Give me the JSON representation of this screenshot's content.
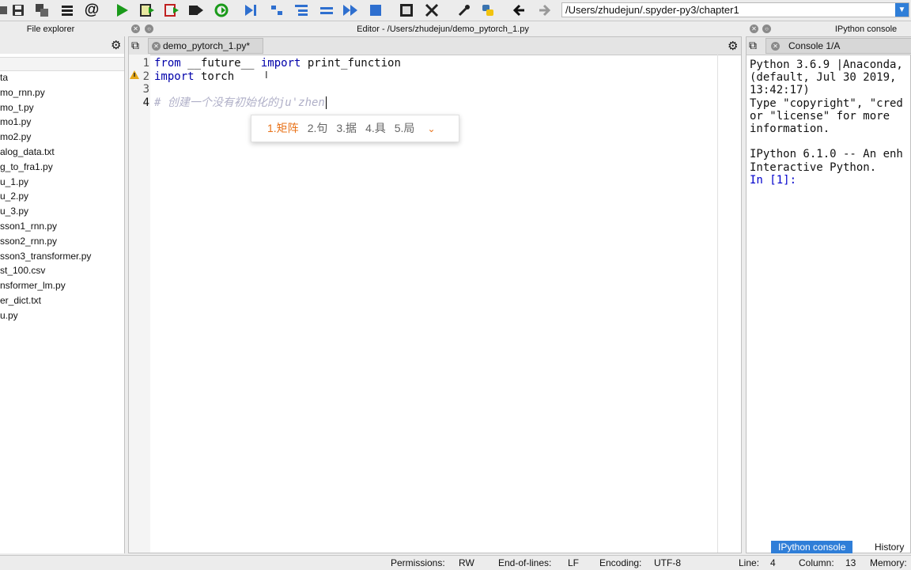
{
  "toolbar": {
    "path": "/Users/zhudejun/.spyder-py3/chapter1"
  },
  "file_explorer": {
    "title": "File explorer",
    "items": [
      "ta",
      "mo_rnn.py",
      "mo_t.py",
      "mo1.py",
      "mo2.py",
      "alog_data.txt",
      "g_to_fra1.py",
      "u_1.py",
      "u_2.py",
      "u_3.py",
      "sson1_rnn.py",
      "sson2_rnn.py",
      "sson3_transformer.py",
      "st_100.csv",
      "nsformer_lm.py",
      "er_dict.txt",
      "u.py"
    ]
  },
  "editor": {
    "title": "Editor - /Users/zhudejun/demo_pytorch_1.py",
    "tab_label": "demo_pytorch_1.py*",
    "line_numbers": [
      "1",
      "2",
      "3",
      "4"
    ],
    "lines": {
      "l1_kw1": "from",
      "l1_rest": " __future__ ",
      "l1_kw2": "import",
      "l1_rest2": " print_function",
      "l2_kw": "import",
      "l2_rest": " torch",
      "l4_comment": "# 创建一个没有初始化的ju'zhen"
    },
    "ime_candidates": [
      "1.矩阵",
      "2.句",
      "3.据",
      "4.具",
      "5.局"
    ]
  },
  "console": {
    "title": "IPython console",
    "tab_label": "Console 1/A",
    "text": "Python 3.6.9 |Anaconda,\n(default, Jul 30 2019,\n13:42:17)\nType \"copyright\", \"cred\nor \"license\" for more\ninformation.\n\nIPython 6.1.0 -- An enh\nInteractive Python.\n",
    "prompt": "In [1]:",
    "bottom_tabs": [
      "IPython console",
      "History"
    ]
  },
  "status": {
    "permissions_label": "Permissions:",
    "permissions": "RW",
    "eol_label": "End-of-lines:",
    "eol": "LF",
    "encoding_label": "Encoding:",
    "encoding": "UTF-8",
    "line_label": "Line:",
    "line": "4",
    "column_label": "Column:",
    "column": "13",
    "memory_label": "Memory:"
  },
  "colors": {
    "accent": "#2f7ed8",
    "keyword": "#0000aa",
    "comment": "#b0b0c8",
    "ime_selected": "#e8731a"
  }
}
